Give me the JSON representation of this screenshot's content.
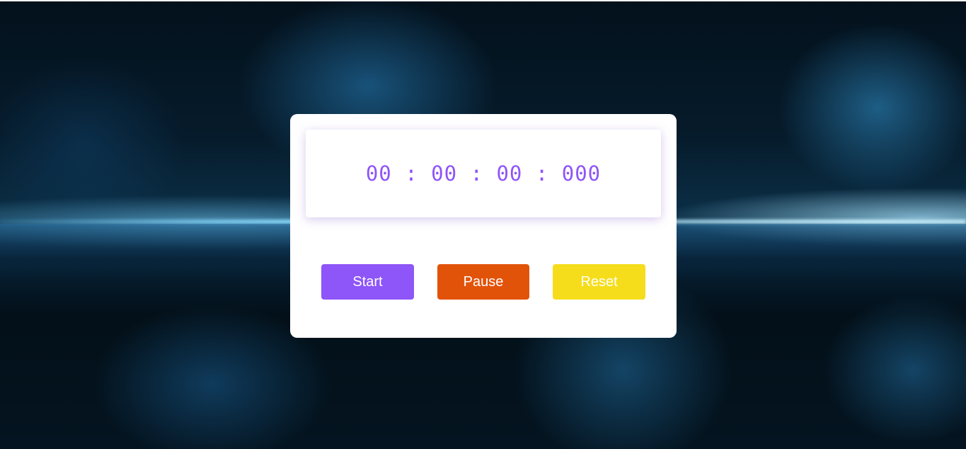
{
  "stopwatch": {
    "hours": "00",
    "minutes": "00",
    "seconds": "00",
    "milliseconds": "000",
    "separator": " : "
  },
  "buttons": {
    "start": {
      "label": "Start",
      "color": "#8e55f8"
    },
    "pause": {
      "label": "Pause",
      "color": "#e2530a"
    },
    "reset": {
      "label": "Reset",
      "color": "#f6dd1c"
    }
  },
  "theme": {
    "display_text_color": "#8e55f8",
    "card_background": "#ffffff",
    "background_icon": "blue-smoke-horizon"
  }
}
